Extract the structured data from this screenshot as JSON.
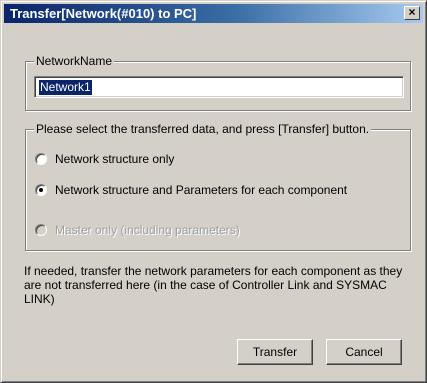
{
  "dialog": {
    "title": "Transfer[Network(#010) to PC]",
    "close_glyph": "×"
  },
  "network_name": {
    "legend": "NetworkName",
    "value": "Network1"
  },
  "transfer_options": {
    "legend": "Please select the transferred data, and press [Transfer] button.",
    "options": [
      {
        "label": "Network structure only",
        "selected": false,
        "enabled": true
      },
      {
        "label": "Network structure and Parameters for each component",
        "selected": true,
        "enabled": true
      },
      {
        "label": "Master only (including parameters)",
        "selected": false,
        "enabled": false
      }
    ]
  },
  "info": {
    "text": "If needed, transfer the network parameters for each component as they are not transferred here (in the case of Controller Link and SYSMAC LINK)"
  },
  "buttons": {
    "transfer": "Transfer",
    "cancel": "Cancel"
  },
  "colors": {
    "face": "#d4d0c8",
    "titlebar_start": "#0a246a",
    "titlebar_end": "#a6caf0",
    "selection": "#0a246a"
  }
}
